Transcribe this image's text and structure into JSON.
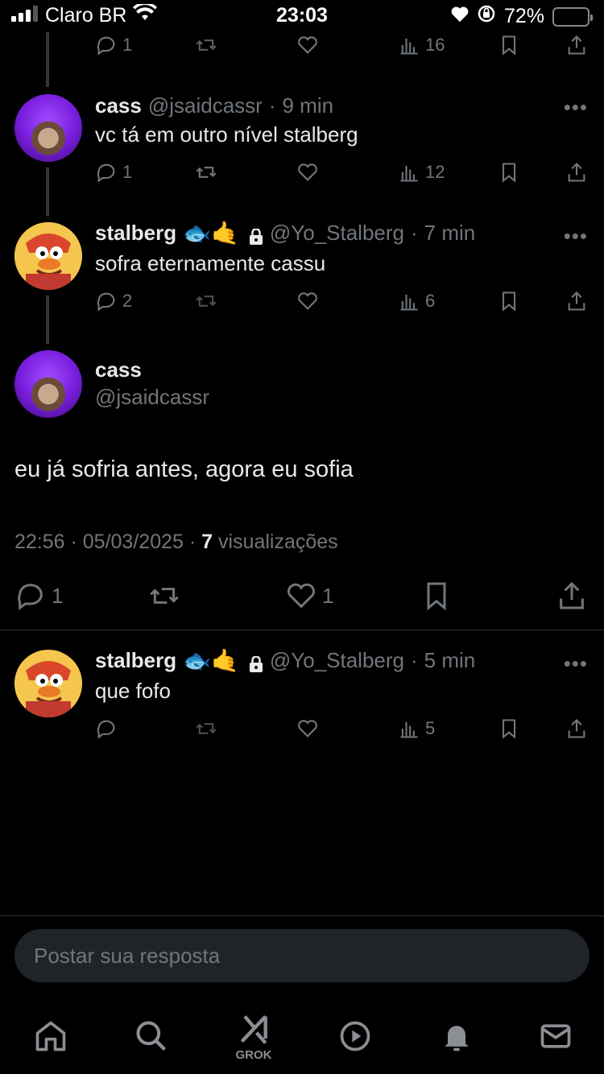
{
  "status_bar": {
    "carrier": "Claro BR",
    "time": "23:03",
    "battery": "72%"
  },
  "replies_above": [
    {
      "name": "",
      "handle": "",
      "time": "",
      "text": "",
      "replies": "1",
      "retweets": "",
      "likes": "",
      "views": "16"
    },
    {
      "name": "cass",
      "handle": "@jsaidcassr",
      "time": "9 min",
      "text": "vc tá em outro nível stalberg",
      "replies": "1",
      "views": "12"
    },
    {
      "name": "stalberg",
      "emojis": "🐟🤙",
      "handle": "@Yo_Stalberg",
      "time": "7 min",
      "text": "sofra eternamente cassu",
      "replies": "2",
      "views": "6"
    }
  ],
  "focused": {
    "name": "cass",
    "handle": "@jsaidcassr",
    "text": "eu já sofria antes, agora eu sofia",
    "timestamp": "22:56 · 05/03/2025 ·",
    "views_count": "7",
    "views_label": "visualizações",
    "replies": "1",
    "likes": "1"
  },
  "reply_below": {
    "name": "stalberg",
    "emojis": "🐟🤙",
    "handle": "@Yo_Stalberg",
    "time": "5 min",
    "text": "que fofo",
    "views": "5"
  },
  "separator": "·",
  "more_glyph": "•••",
  "compose": {
    "placeholder": "Postar sua resposta"
  },
  "nav": {
    "grok_label": "GROK"
  },
  "colors": {
    "background": "#000000",
    "primary_text": "#e7e9ea",
    "secondary_text": "#71767b",
    "divider": "#2f3336",
    "compose_bg": "#202327"
  }
}
